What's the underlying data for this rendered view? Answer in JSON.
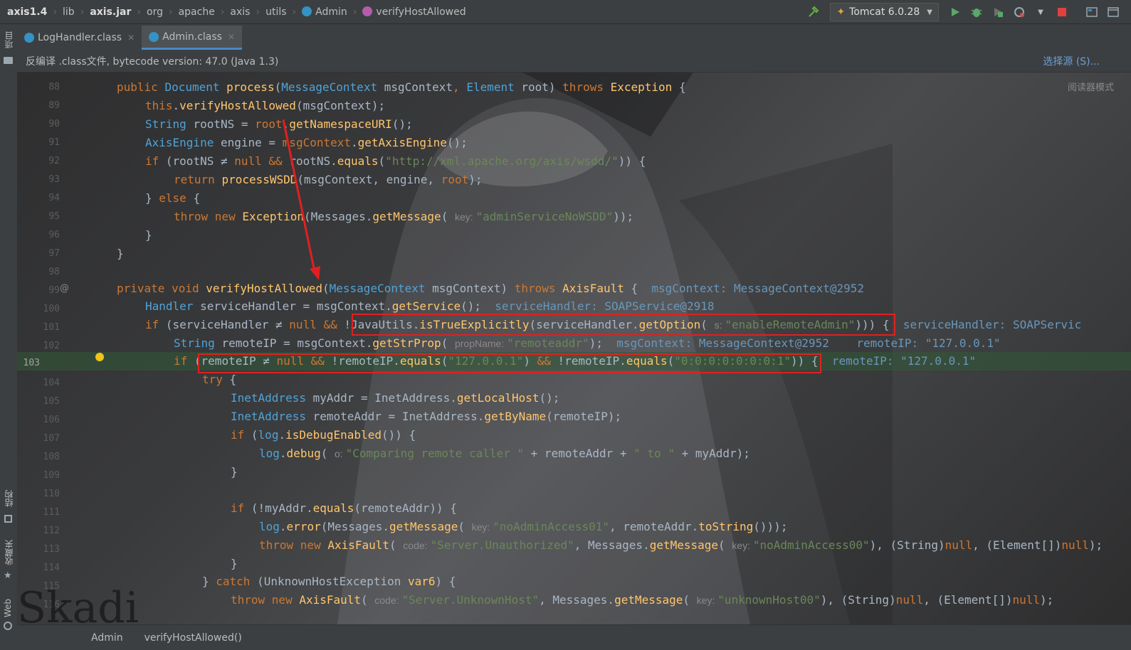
{
  "breadcrumb": [
    "axis1.4",
    "lib",
    "axis.jar",
    "org",
    "apache",
    "axis",
    "utils",
    "Admin",
    "verifyHostAllowed"
  ],
  "run_config": "Tomcat 6.0.28",
  "tabs": [
    {
      "label": "LogHandler.class",
      "active": false
    },
    {
      "label": "Admin.class",
      "active": true
    }
  ],
  "infobar": {
    "text": "反编译 .class文件, bytecode version: 47.0 (Java 1.3)",
    "link": "选择源 (S)..."
  },
  "reader_mode": "阅读器模式",
  "left_strip": {
    "project": "项目",
    "structure": "结构",
    "favorites": "收藏夹",
    "web": "Web"
  },
  "current_line": "103",
  "line_numbers": [
    "88",
    "89",
    "90",
    "91",
    "92",
    "93",
    "94",
    "95",
    "96",
    "97",
    "98",
    "99",
    "100",
    "101",
    "102",
    "103",
    "104",
    "105",
    "106",
    "107",
    "108",
    "109",
    "110",
    "111",
    "112",
    "113",
    "114",
    "115",
    "116"
  ],
  "code": {
    "l88": {
      "a": "public ",
      "b": "Document ",
      "c": "process",
      "d": "(",
      "e": "MessageContext ",
      "f": "msgContext",
      "g": ", ",
      "h": "Element ",
      "i": "root",
      "j": ") ",
      "k": "throws ",
      "l": "Exception ",
      "m": "{"
    },
    "l89": {
      "a": "this",
      "b": ".",
      "c": "verifyHostAllowed",
      "d": "(msgContext);"
    },
    "l90": {
      "a": "String ",
      "b": "rootNS = ",
      "c": "root",
      "d": ".",
      "e": "getNamespaceURI",
      "f": "();"
    },
    "l91": {
      "a": "AxisEngine ",
      "b": "engine = ",
      "c": "msgContext",
      "d": ".",
      "e": "getAxisEngine",
      "f": "();"
    },
    "l92": {
      "a": "if ",
      "b": "(rootNS ≠ ",
      "c": "null ",
      "d": "&& ",
      "e": "rootNS.",
      "f": "equals",
      "g": "(",
      "h": "\"http://xml.apache.org/axis/wsdd/\"",
      "i": ")) {"
    },
    "l93": {
      "a": "return ",
      "b": "processWSDD",
      "c": "(msgContext, engine, ",
      "d": "root",
      "e": ");"
    },
    "l94": {
      "a": "} ",
      "b": "else ",
      "c": "{"
    },
    "l95": {
      "a": "throw new ",
      "b": "Exception",
      "c": "(Messages.",
      "d": "getMessage",
      "e": "( ",
      "f": "key: ",
      "g": "\"adminServiceNoWSDD\"",
      "h": "));"
    },
    "l96": "}",
    "l97": "}",
    "l99": {
      "a": "private void ",
      "b": "verifyHostAllowed",
      "c": "(",
      "d": "MessageContext ",
      "e": "msgContext) ",
      "f": "throws ",
      "g": "AxisFault ",
      "h": "{  ",
      "i": "msgContext: MessageContext@2952"
    },
    "l100": {
      "a": "Handler ",
      "b": "serviceHandler = msgContext.",
      "c": "getService",
      "d": "();  ",
      "e": "serviceHandler: SOAPService@2918"
    },
    "l101": {
      "a": "if ",
      "b": "(serviceHandler ≠ ",
      "c": "null ",
      "d": "&& ",
      "e": "!JavaUtils.",
      "f": "isTrueExplicitly",
      "g": "(serviceHandler.",
      "h": "getOption",
      "i": "( ",
      "j": "s: ",
      "k": "\"enableRemoteAdmin\"",
      "l": "))) {  ",
      "m": "serviceHandler: SOAPServic"
    },
    "l102": {
      "a": "String ",
      "b": "remoteIP = msgContext.",
      "c": "getStrProp",
      "d": "( ",
      "e": "propName: ",
      "f": "\"remoteaddr\"",
      "g": ");  ",
      "h": "msgContext: MessageContext@2952    remoteIP: \"127.0.0.1\""
    },
    "l103": {
      "a": "if ",
      "b": "(remoteIP ≠ ",
      "c": "null ",
      "d": "&& ",
      "e": "!remoteIP.",
      "f": "equals",
      "g": "(",
      "h": "\"127.0.0.1\"",
      "i": ") ",
      "j": "&& ",
      "k": "!remoteIP.",
      "l": "equals",
      "m": "(",
      "n": "\"0:0:0:0:0:0:0:1\"",
      "o": ")) {  ",
      "p": "remoteIP: \"127.0.0.1\""
    },
    "l104": {
      "a": "try ",
      "b": "{"
    },
    "l105": {
      "a": "InetAddress ",
      "b": "myAddr = InetAddress.",
      "c": "getLocalHost",
      "d": "();"
    },
    "l106": {
      "a": "InetAddress ",
      "b": "remoteAddr = InetAddress.",
      "c": "getByName",
      "d": "(remoteIP);"
    },
    "l107": {
      "a": "if ",
      "b": "(",
      "c": "log",
      "d": ".",
      "e": "isDebugEnabled",
      "f": "()) {"
    },
    "l108": {
      "a": "log",
      "b": ".",
      "c": "debug",
      "d": "( ",
      "e": "o: ",
      "f": "\"Comparing remote caller \" ",
      "g": "+ remoteAddr + ",
      "h": "\" to \" ",
      "i": "+ myAddr);"
    },
    "l109": "}",
    "l111": {
      "a": "if ",
      "b": "(!myAddr.",
      "c": "equals",
      "d": "(remoteAddr)) {"
    },
    "l112": {
      "a": "log",
      "b": ".",
      "c": "error",
      "d": "(Messages.",
      "e": "getMessage",
      "f": "( ",
      "g": "key: ",
      "h": "\"noAdminAccess01\"",
      "i": ", remoteAddr.",
      "j": "toString",
      "k": "()));"
    },
    "l113": {
      "a": "throw new ",
      "b": "AxisFault",
      "c": "( ",
      "d": "code: ",
      "e": "\"Server.Unauthorized\"",
      "f": ", Messages.",
      "g": "getMessage",
      "h": "( ",
      "i": "key: ",
      "j": "\"noAdminAccess00\"",
      "k": "), (String)",
      "l": "null",
      "m": ", (Element[])",
      "n": "null",
      "o": ");"
    },
    "l114": "}",
    "l115": {
      "a": "} ",
      "b": "catch ",
      "c": "(UnknownHostException ",
      "d": "var6",
      "e": ") {"
    },
    "l116": {
      "a": "throw new ",
      "b": "AxisFault",
      "c": "( ",
      "d": "code: ",
      "e": "\"Server.UnknownHost\"",
      "f": ", Messages.",
      "g": "getMessage",
      "h": "( ",
      "i": "key: ",
      "j": "\"unknownHost00\"",
      "k": "), (String)",
      "l": "null",
      "m": ", (Element[])",
      "n": "null",
      "o": ");"
    }
  },
  "bottom_breadcrumb": [
    "Admin",
    "verifyHostAllowed()"
  ],
  "watermark": "Skadi"
}
